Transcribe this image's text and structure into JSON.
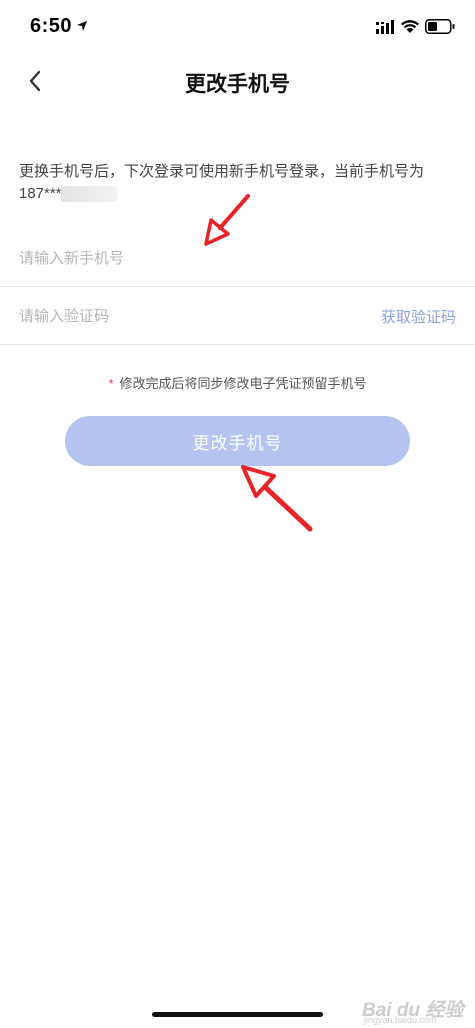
{
  "status": {
    "time": "6:50"
  },
  "nav": {
    "title": "更改手机号"
  },
  "hint": {
    "text": "更换手机号后，下次登录可使用新手机号登录，当前手机号为",
    "masked_phone": "187****"
  },
  "phone_field": {
    "placeholder": "请输入新手机号",
    "value": ""
  },
  "code_field": {
    "placeholder": "请输入验证码",
    "value": "",
    "get_code_label": "获取验证码"
  },
  "note": {
    "asterisk": "*",
    "text": "修改完成后将同步修改电子凭证预留手机号"
  },
  "submit": {
    "label": "更改手机号"
  },
  "watermark": {
    "main": "Bai du 经验",
    "sub": "jingyan.baidu.com"
  },
  "colors": {
    "accent": "#8aa2e2",
    "button_bg": "#b5c3f0",
    "annotation_red": "#e8242b",
    "asterisk_red": "#e64545"
  },
  "icons": {
    "back": "chevron-left-icon",
    "location": "location-arrow-icon",
    "signal": "cellular-signal-icon",
    "wifi": "wifi-icon",
    "battery": "battery-icon"
  }
}
